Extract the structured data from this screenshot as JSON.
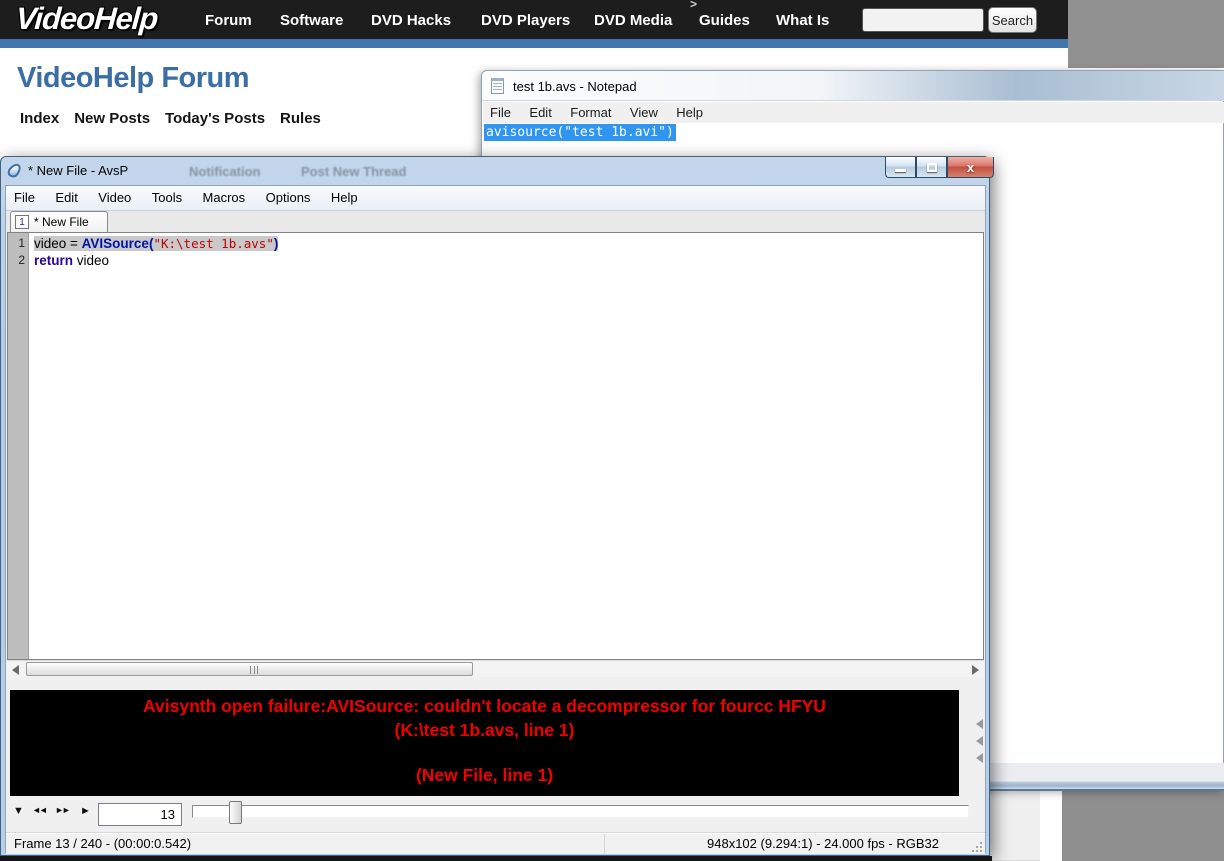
{
  "site_header": {
    "logo": "VideoHelp",
    "nav": [
      "Forum",
      "Software",
      "DVD Hacks",
      "DVD Players",
      "DVD Media",
      "Guides",
      "What Is"
    ],
    "search_value": "",
    "search_button": "Search",
    "stray_caret": ">"
  },
  "forum": {
    "title": "VideoHelp Forum",
    "links": [
      "Index",
      "New Posts",
      "Today's Posts",
      "Rules"
    ]
  },
  "notepad": {
    "title": "test 1b.avs - Notepad",
    "menu": [
      "File",
      "Edit",
      "Format",
      "View",
      "Help"
    ],
    "selected_text": "avisource(\"test 1b.avi\")"
  },
  "avsp": {
    "title": "* New File - AvsP",
    "ghost": [
      "Notification",
      "Post New Thread"
    ],
    "menu": [
      "File",
      "Edit",
      "Video",
      "Tools",
      "Macros",
      "Options",
      "Help"
    ],
    "tab": {
      "index": "1",
      "label": "* New File"
    },
    "code": {
      "line1_num": "1",
      "line1_t1": "video = ",
      "line1_t2": "AVISource(",
      "line1_t3": "\"K:\\test 1b.avs\"",
      "line1_t4": ")",
      "line2_num": "2",
      "line2_t1": "return",
      "line2_t2": " video"
    },
    "error": {
      "line1": "Avisynth open failure:AVISource: couldn't locate a decompressor for fourcc HFYU",
      "line2": "(K:\\test 1b.avs, line 1)",
      "line3": "(New File, line 1)"
    },
    "transport": {
      "menu": "▼",
      "prev": "◄◄",
      "next": "►►",
      "play": "►"
    },
    "frame_number": "13",
    "status_left": "Frame 13 / 240  -  (00:00:0.542)",
    "status_right": "948x102 (9.294:1)  -  24.000 fps  -  RGB32"
  },
  "colors": {
    "header_bg": "#1d1d1d",
    "header_accent_bar": "#4177ae",
    "forum_title_blue": "#3b6ea5",
    "notepad_selection": "#3095f0",
    "avsp_glass": "#b9cee7",
    "code_function": "#0013a8",
    "code_keyword": "#2b0096",
    "code_string": "#c00000",
    "error_red": "#f10000",
    "video_pane": "#000000"
  }
}
